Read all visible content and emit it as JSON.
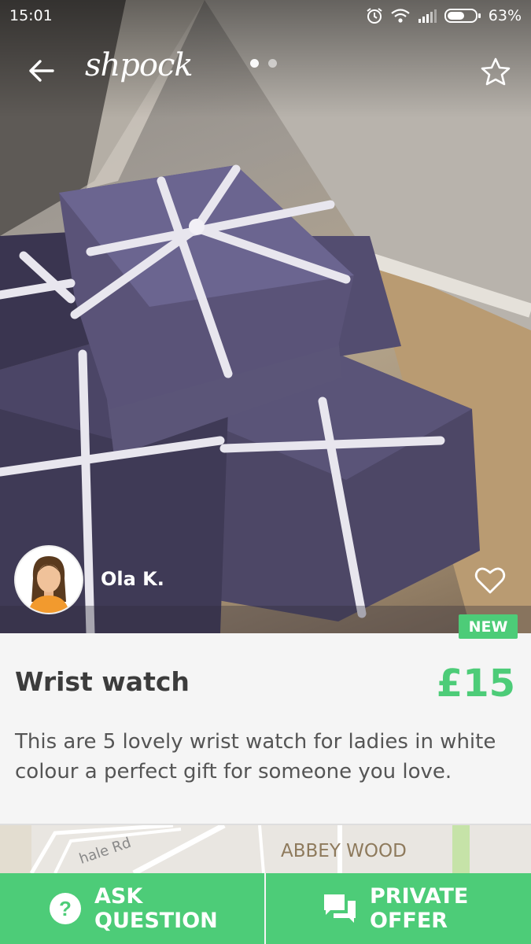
{
  "status_bar": {
    "time": "15:01",
    "battery": "63%",
    "battery_level": 0.63,
    "icons": [
      "alarm-icon",
      "wifi-icon",
      "signal-icon",
      "battery-icon"
    ]
  },
  "toolbar": {
    "logo": "shpock",
    "back_icon": "arrow-left-icon",
    "favorite_icon": "star-icon",
    "pager": {
      "count": 2,
      "active": 1
    }
  },
  "seller": {
    "name": "Ola K.",
    "like_icon": "heart-icon"
  },
  "badge": "NEW",
  "listing": {
    "title": "Wrist watch",
    "price": "£15",
    "description": "This are 5 lovely wrist watch for ladies in white colour a perfect gift for someone you love."
  },
  "map": {
    "area_label": "ABBEY WOOD",
    "road_label": "hale Rd"
  },
  "actions": {
    "ask": {
      "line1": "ASK",
      "line2": "QUESTION",
      "icon": "question-circle-icon"
    },
    "offer": {
      "line1": "PRIVATE",
      "line2": "OFFER",
      "icon": "chat-bubbles-icon"
    }
  },
  "colors": {
    "accent": "#4dcc78",
    "text_dark": "#3c3c3c",
    "text_body": "#555555",
    "box_purple": "#4a4466",
    "ribbon": "#e8e6ee"
  }
}
